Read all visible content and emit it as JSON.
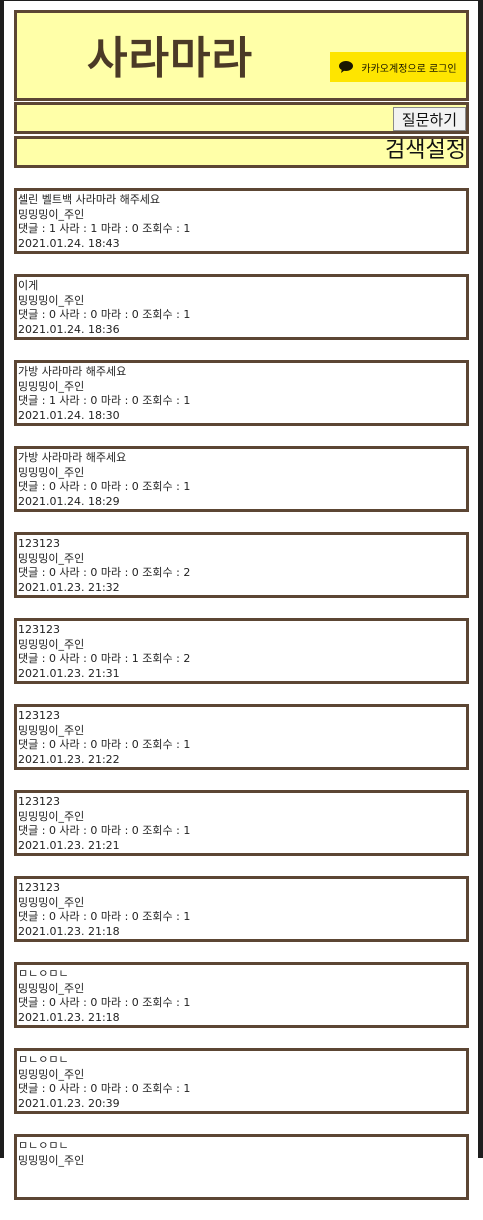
{
  "header": {
    "title": "사라마라",
    "login_label": "카카오계정으로 로그인",
    "accent_color": "#ffffa8",
    "border_color": "#5c4634",
    "kakao_color": "#fee500"
  },
  "toolbar": {
    "ask_label": "질문하기",
    "search_settings_label": "검색설정"
  },
  "posts": [
    {
      "title": "셀린 벨트백 사라마라 해주세요",
      "author": "밍밍밍이_주인",
      "stats": "댓글 : 1 사라 : 1 마라 : 0 조회수 : 1",
      "date": "2021.01.24. 18:43"
    },
    {
      "title": "이게",
      "author": "밍밍밍이_주인",
      "stats": "댓글 : 0 사라 : 0 마라 : 0 조회수 : 1",
      "date": "2021.01.24. 18:36"
    },
    {
      "title": "가방 사라마라 해주세요",
      "author": "밍밍밍이_주인",
      "stats": "댓글 : 1 사라 : 0 마라 : 0 조회수 : 1",
      "date": "2021.01.24. 18:30"
    },
    {
      "title": "가방 사라마라 해주세요",
      "author": "밍밍밍이_주인",
      "stats": "댓글 : 0 사라 : 0 마라 : 0 조회수 : 1",
      "date": "2021.01.24. 18:29"
    },
    {
      "title": "123123",
      "author": "밍밍밍이_주인",
      "stats": "댓글 : 0 사라 : 0 마라 : 0 조회수 : 2",
      "date": "2021.01.23. 21:32"
    },
    {
      "title": "123123",
      "author": "밍밍밍이_주인",
      "stats": "댓글 : 0 사라 : 0 마라 : 1 조회수 : 2",
      "date": "2021.01.23. 21:31"
    },
    {
      "title": "123123",
      "author": "밍밍밍이_주인",
      "stats": "댓글 : 0 사라 : 0 마라 : 0 조회수 : 1",
      "date": "2021.01.23. 21:22"
    },
    {
      "title": "123123",
      "author": "밍밍밍이_주인",
      "stats": "댓글 : 0 사라 : 0 마라 : 0 조회수 : 1",
      "date": "2021.01.23. 21:21"
    },
    {
      "title": "123123",
      "author": "밍밍밍이_주인",
      "stats": "댓글 : 0 사라 : 0 마라 : 0 조회수 : 1",
      "date": "2021.01.23. 21:18"
    },
    {
      "title": "ㅁㄴㅇㅁㄴ",
      "author": "밍밍밍이_주인",
      "stats": "댓글 : 0 사라 : 0 마라 : 0 조회수 : 1",
      "date": "2021.01.23. 21:18"
    },
    {
      "title": "ㅁㄴㅇㅁㄴ",
      "author": "밍밍밍이_주인",
      "stats": "댓글 : 0 사라 : 0 마라 : 0 조회수 : 1",
      "date": "2021.01.23. 20:39"
    },
    {
      "title": "ㅁㄴㅇㅁㄴ",
      "author": "밍밍밍이_주인",
      "stats": "",
      "date": ""
    }
  ]
}
